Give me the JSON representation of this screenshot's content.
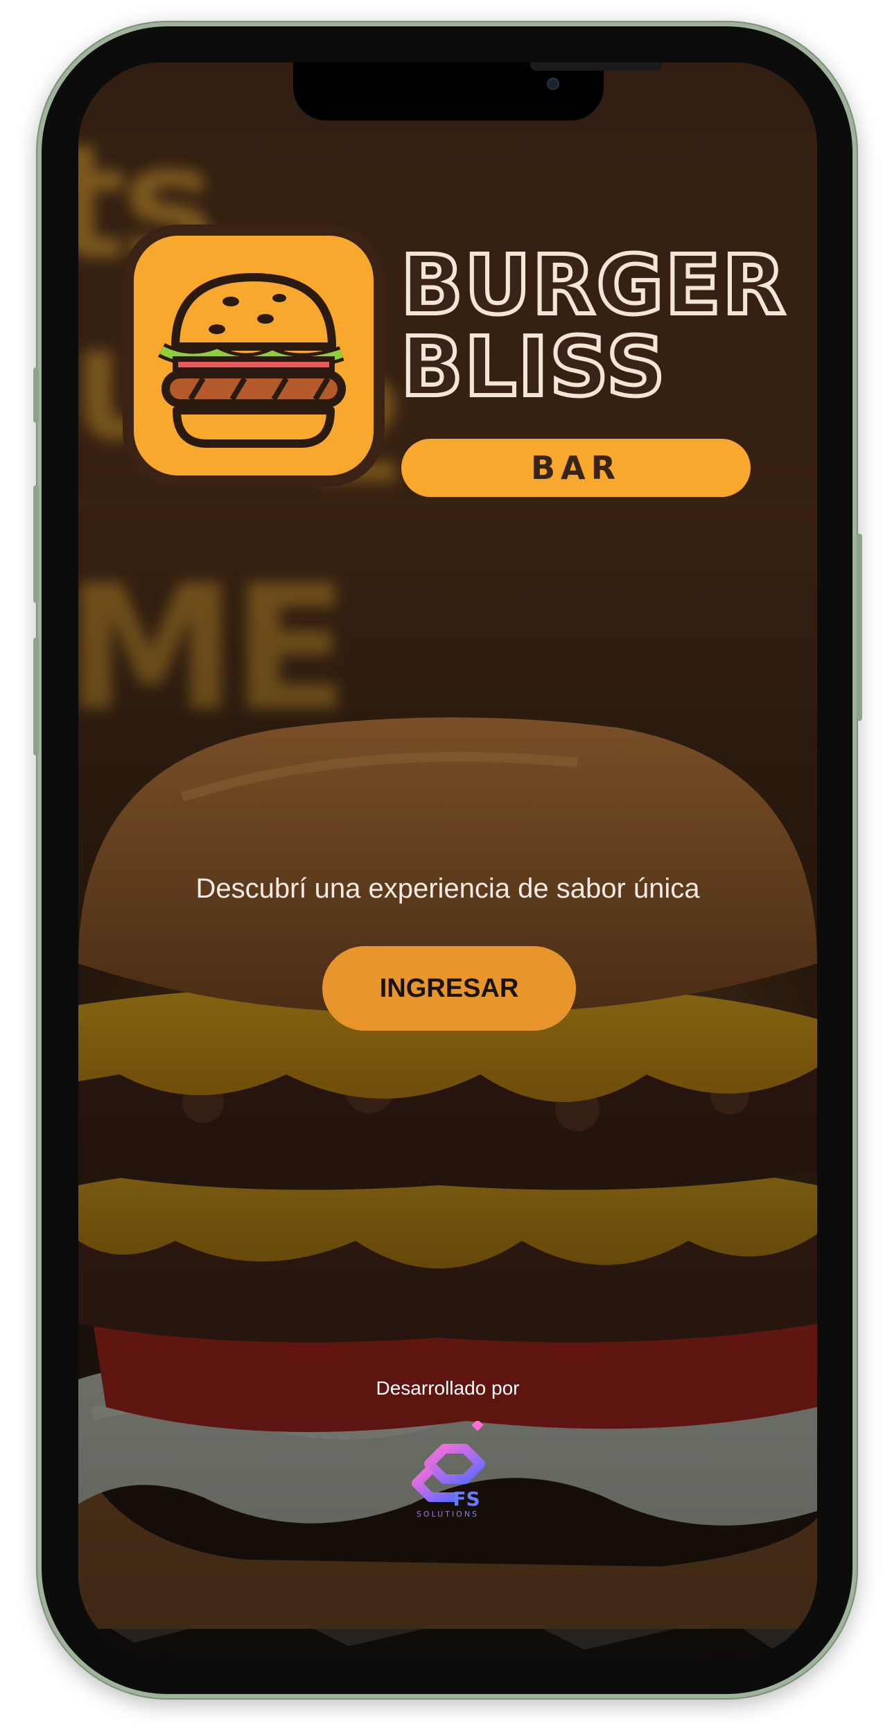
{
  "brand": {
    "name_line1": "BURGER",
    "name_line2": "BLISS",
    "badge": "BAR"
  },
  "hero": {
    "tagline": "Descubrí una experiencia de sabor única",
    "cta_label": "INGRESAR"
  },
  "footer": {
    "developed_by": "Desarrollado por",
    "developer_logo_text": "FS",
    "developer_logo_subtext": "SOLUTIONS"
  },
  "colors": {
    "accent": "#f7a82d",
    "button": "#e8962c",
    "frame": "#9fb49a"
  },
  "icons": {
    "logo": "burger-icon",
    "developer": "fs-solutions-logo"
  }
}
